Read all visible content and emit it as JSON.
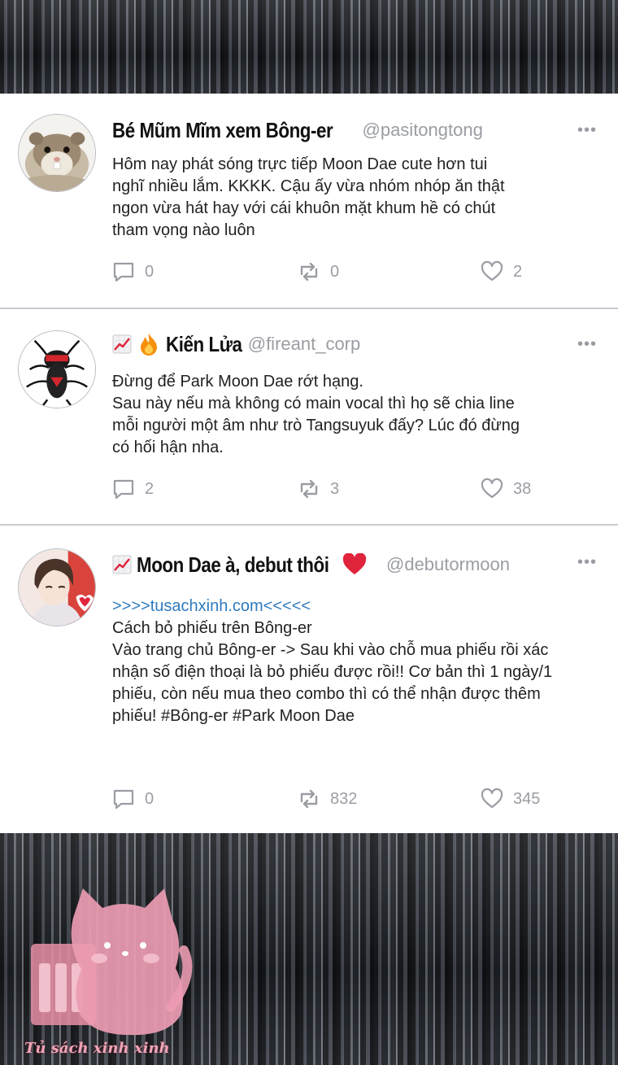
{
  "tweets": [
    {
      "display_name": "Bé Mũm Mĩm xem Bông-er",
      "handle": "@pasitongtong",
      "avatar": "hamster-avatar",
      "more": "•••",
      "body": [
        "Hôm nay phát sóng trực tiếp Moon Dae cute hơn tui",
        "nghĩ nhiều lắm. KKKK. Cậu ấy vừa nhóm nhóp ăn thật",
        "ngon vừa hát hay với cái khuôn mặt khum hề có chút",
        "tham vọng nào luôn"
      ],
      "replies": "0",
      "retweets": "0",
      "likes": "2"
    },
    {
      "display_name": "Kiến Lửa",
      "handle": "@fireant_corp",
      "avatar": "fire-ant-avatar",
      "name_icons": [
        "chart-increasing-icon",
        "fire-icon"
      ],
      "more": "•••",
      "body": [
        "Đừng để Park Moon Dae rớt hạng.",
        "Sau này nếu mà không có main vocal thì họ sẽ chia line",
        "mỗi người một âm như trò Tangsuyuk đấy? Lúc đó đừng",
        "có hối hận nha."
      ],
      "replies": "2",
      "retweets": "3",
      "likes": "38"
    },
    {
      "display_name": "Moon Dae à, debut thôi",
      "handle": "@debutormoon",
      "avatar": "boy-avatar",
      "name_icons": [
        "chart-increasing-icon",
        "red-heart-icon"
      ],
      "more": "•••",
      "link": ">>>>tusachxinh.com<<<<<",
      "body": [
        "Cách bỏ phiếu trên Bông-er",
        "Vào trang chủ Bông-er -> Sau khi vào chỗ mua phiếu rồi xác",
        "nhận số điện thoại là bỏ phiếu được rồi!! Cơ bản thì 1 ngày/1",
        "phiếu, còn nếu mua theo combo thì có thể nhận được thêm",
        "phiếu! #Bông-er #Park Moon Dae"
      ],
      "replies": "0",
      "retweets": "832",
      "likes": "345"
    }
  ],
  "watermark": {
    "text": "Tủ sách xinh xinh",
    "icon": "pink-cat-books-logo",
    "color": "#f0a5b6"
  },
  "colors": {
    "card_bg": "#ffffff",
    "muted": "#9a9da3",
    "link": "#2e7bbf",
    "heart": "#e0243b"
  }
}
